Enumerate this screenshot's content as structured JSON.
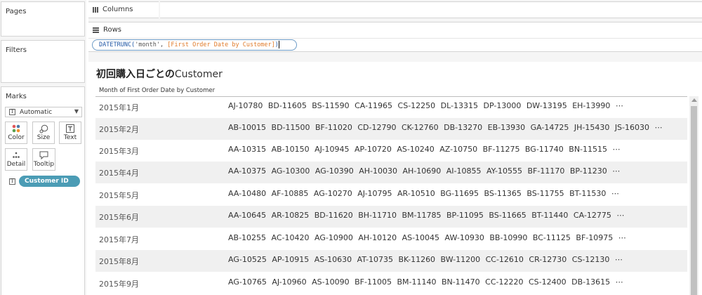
{
  "cards": {
    "pages_title": "Pages",
    "filters_title": "Filters",
    "marks_title": "Marks"
  },
  "marks": {
    "mark_type": "Automatic",
    "color_label": "Color",
    "size_label": "Size",
    "text_label": "Text",
    "detail_label": "Detail",
    "tooltip_label": "Tooltip",
    "field_pill": "Customer ID",
    "text_glyph": "T"
  },
  "shelves": {
    "columns_label": "Columns",
    "rows_label": "Rows",
    "formula": {
      "fn": "DATETRUNC(",
      "arg": "'month', ",
      "field": "[First Order Date by Customer]",
      "close": ")"
    }
  },
  "viz": {
    "title_bold": "初回購入日ごとの",
    "title_rest": "Customer",
    "column_header": "Month of First Order Date by Customer",
    "rows": [
      {
        "date": "2015年1月",
        "ids": "AJ-10780 BD-11605 BS-11590 CA-11965 CS-12250 DL-13315 DP-13000 DW-13195 EH-13990 ⋯"
      },
      {
        "date": "2015年2月",
        "ids": "AB-10015 BD-11500 BF-11020 CD-12790 CK-12760 DB-13270 EB-13930 GA-14725 JH-15430 JS-16030 ⋯"
      },
      {
        "date": "2015年3月",
        "ids": "AA-10315 AB-10150 AJ-10945 AP-10720 AS-10240 AZ-10750 BF-11275 BG-11740 BN-11515 ⋯"
      },
      {
        "date": "2015年4月",
        "ids": "AA-10375 AG-10300 AG-10390 AH-10030 AH-10690 AI-10855 AY-10555 BF-11170 BP-11230 ⋯"
      },
      {
        "date": "2015年5月",
        "ids": "AA-10480 AF-10885 AG-10270 AJ-10795 AR-10510 BG-11695 BS-11365 BS-11755 BT-11530 ⋯"
      },
      {
        "date": "2015年6月",
        "ids": "AA-10645 AR-10825 BD-11620 BH-11710 BM-11785 BP-11095 BS-11665 BT-11440 CA-12775 ⋯"
      },
      {
        "date": "2015年7月",
        "ids": "AB-10255 AC-10420 AG-10900 AH-10120 AS-10045 AW-10930 BB-10990 BC-11125 BF-10975 ⋯"
      },
      {
        "date": "2015年8月",
        "ids": "AG-10525 AP-10915 AS-10630 AT-10735 BK-11260 BW-11200 CC-12610 CR-12730 CS-12130 ⋯"
      },
      {
        "date": "2015年9月",
        "ids": "AG-10765 AJ-10960 AS-10090 BF-11005 BM-11140 BN-11470 CC-12220 CS-12400 DB-13615 ⋯"
      }
    ]
  },
  "colors": {
    "pill": "#4b9cb5",
    "calc_border": "#6c9bc7",
    "calc_field": "#e07c2c",
    "calc_function": "#1f57a5",
    "alt_row": "#f0f0f0"
  },
  "icons": {
    "columns_shelf": "columns-bars-icon",
    "rows_shelf": "rows-lines-icon",
    "color": "color-dots-icon",
    "size": "size-icon",
    "text": "text-icon",
    "detail": "detail-dots-icon",
    "tooltip": "tooltip-icon"
  }
}
